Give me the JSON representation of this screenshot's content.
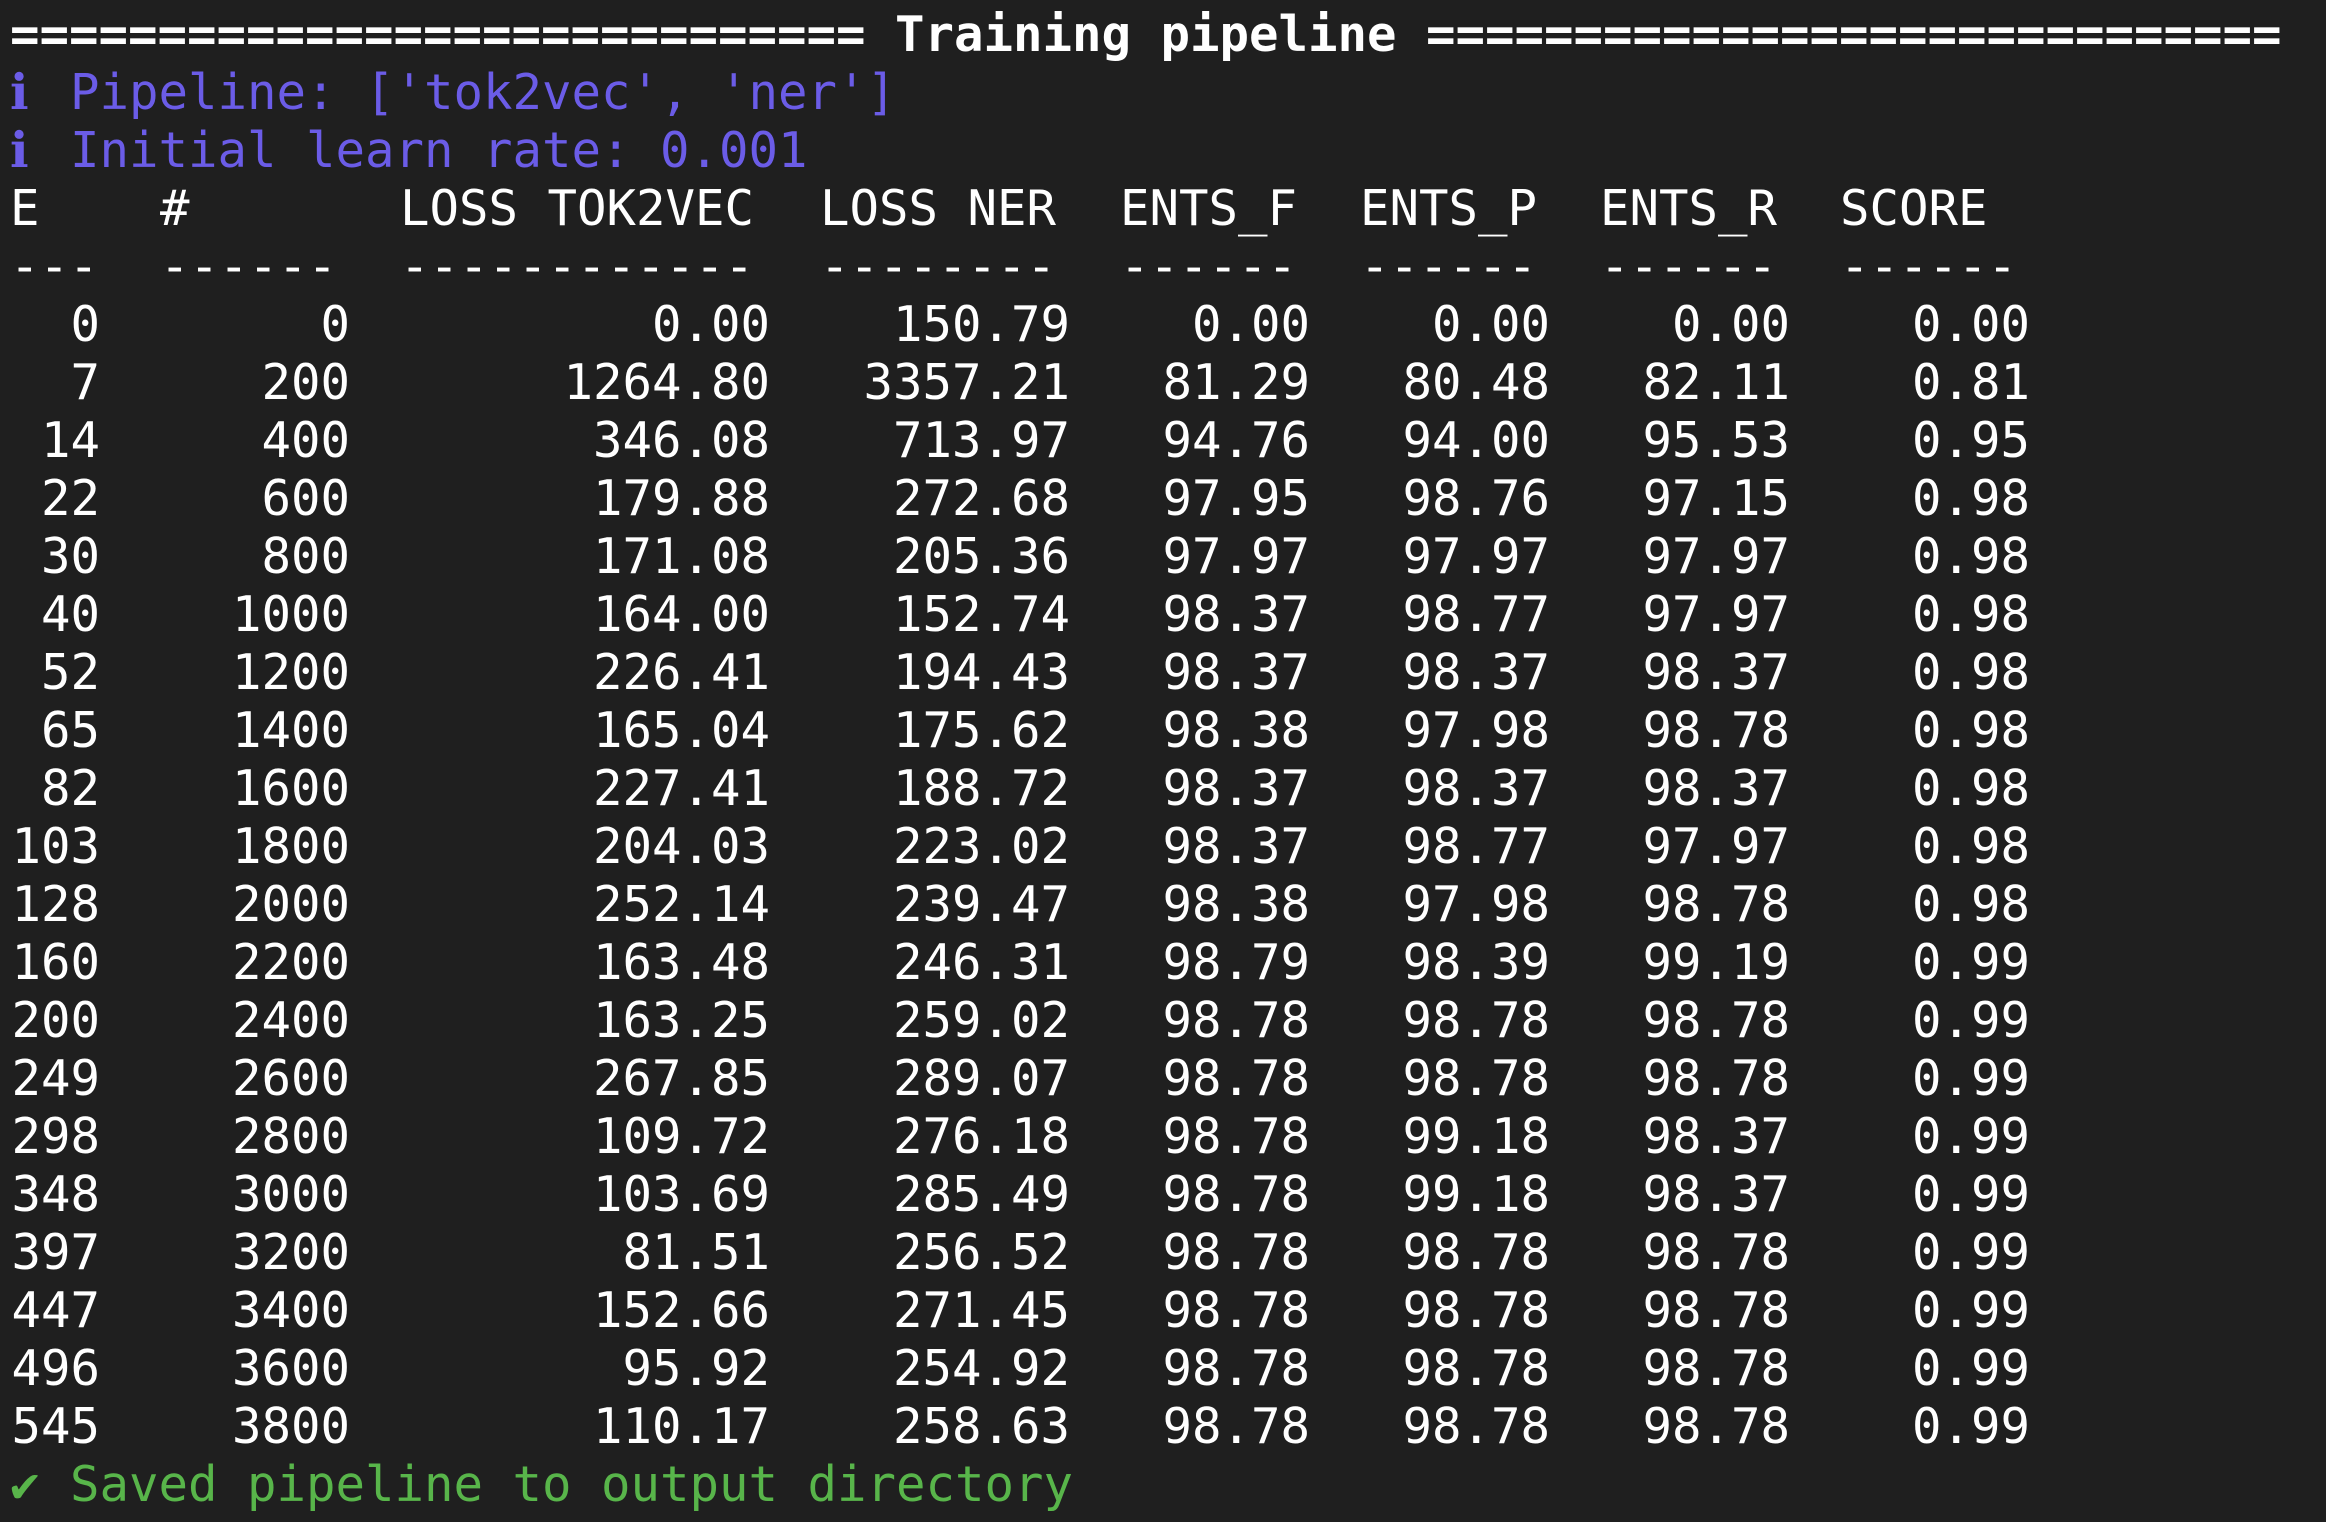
{
  "banner": "============================= Training pipeline =============================",
  "info_lines": [
    {
      "glyph": "ℹ",
      "text": "Pipeline: ['tok2vec', 'ner']"
    },
    {
      "glyph": "ℹ",
      "text": "Initial learn rate: 0.001"
    }
  ],
  "table": {
    "headers": [
      "E",
      "#",
      "LOSS TOK2VEC",
      "LOSS NER",
      "ENTS_F",
      "ENTS_P",
      "ENTS_R",
      "SCORE"
    ],
    "separators": [
      "---",
      "------",
      "------------",
      "--------",
      "------",
      "------",
      "------",
      "------"
    ],
    "rows": [
      [
        "0",
        "0",
        "0.00",
        "150.79",
        "0.00",
        "0.00",
        "0.00",
        "0.00"
      ],
      [
        "7",
        "200",
        "1264.80",
        "3357.21",
        "81.29",
        "80.48",
        "82.11",
        "0.81"
      ],
      [
        "14",
        "400",
        "346.08",
        "713.97",
        "94.76",
        "94.00",
        "95.53",
        "0.95"
      ],
      [
        "22",
        "600",
        "179.88",
        "272.68",
        "97.95",
        "98.76",
        "97.15",
        "0.98"
      ],
      [
        "30",
        "800",
        "171.08",
        "205.36",
        "97.97",
        "97.97",
        "97.97",
        "0.98"
      ],
      [
        "40",
        "1000",
        "164.00",
        "152.74",
        "98.37",
        "98.77",
        "97.97",
        "0.98"
      ],
      [
        "52",
        "1200",
        "226.41",
        "194.43",
        "98.37",
        "98.37",
        "98.37",
        "0.98"
      ],
      [
        "65",
        "1400",
        "165.04",
        "175.62",
        "98.38",
        "97.98",
        "98.78",
        "0.98"
      ],
      [
        "82",
        "1600",
        "227.41",
        "188.72",
        "98.37",
        "98.37",
        "98.37",
        "0.98"
      ],
      [
        "103",
        "1800",
        "204.03",
        "223.02",
        "98.37",
        "98.77",
        "97.97",
        "0.98"
      ],
      [
        "128",
        "2000",
        "252.14",
        "239.47",
        "98.38",
        "97.98",
        "98.78",
        "0.98"
      ],
      [
        "160",
        "2200",
        "163.48",
        "246.31",
        "98.79",
        "98.39",
        "99.19",
        "0.99"
      ],
      [
        "200",
        "2400",
        "163.25",
        "259.02",
        "98.78",
        "98.78",
        "98.78",
        "0.99"
      ],
      [
        "249",
        "2600",
        "267.85",
        "289.07",
        "98.78",
        "98.78",
        "98.78",
        "0.99"
      ],
      [
        "298",
        "2800",
        "109.72",
        "276.18",
        "98.78",
        "99.18",
        "98.37",
        "0.99"
      ],
      [
        "348",
        "3000",
        "103.69",
        "285.49",
        "98.78",
        "99.18",
        "98.37",
        "0.99"
      ],
      [
        "397",
        "3200",
        "81.51",
        "256.52",
        "98.78",
        "98.78",
        "98.78",
        "0.99"
      ],
      [
        "447",
        "3400",
        "152.66",
        "271.45",
        "98.78",
        "98.78",
        "98.78",
        "0.99"
      ],
      [
        "496",
        "3600",
        "95.92",
        "254.92",
        "98.78",
        "98.78",
        "98.78",
        "0.99"
      ],
      [
        "545",
        "3800",
        "110.17",
        "258.63",
        "98.78",
        "98.78",
        "98.78",
        "0.99"
      ]
    ]
  },
  "success": {
    "glyph": "✔",
    "text": "Saved pipeline to output directory"
  },
  "colors": {
    "background": "#1f1f1f",
    "text": "#ffffff",
    "info": "#6b5ce7",
    "success": "#58b54a"
  }
}
